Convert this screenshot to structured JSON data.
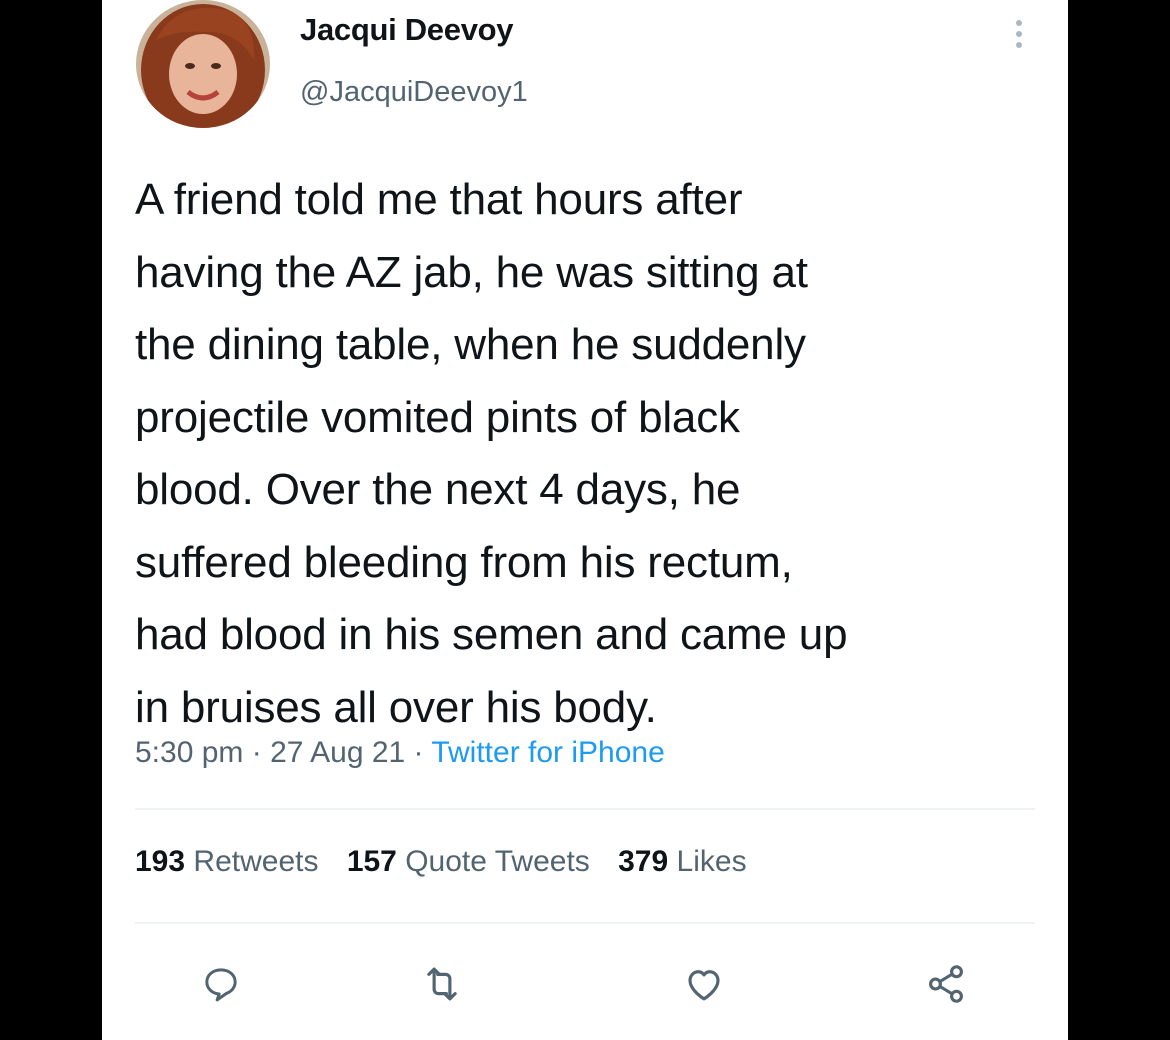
{
  "tweet": {
    "author": {
      "display_name": "Jacqui Deevoy",
      "handle": "@JacquiDeevoy1"
    },
    "text": "A friend told me that hours after\nhaving the AZ jab, he was sitting at\nthe dining table, when he suddenly\nprojectile vomited pints of black\nblood. Over the next 4 days, he\nsuffered bleeding from his rectum,\nhad blood in his semen and came up\nin bruises all over his body.",
    "time": "5:30 pm",
    "date": "27 Aug 21",
    "separator": " · ",
    "source": "Twitter for iPhone",
    "stats": {
      "retweets": {
        "count": "193",
        "label": "Retweets"
      },
      "quotes": {
        "count": "157",
        "label": "Quote Tweets"
      },
      "likes": {
        "count": "379",
        "label": "Likes"
      }
    },
    "actions": [
      "reply-icon",
      "retweet-icon",
      "like-icon",
      "share-icon"
    ]
  },
  "colors": {
    "text": "#0f1419",
    "secondary": "#536471",
    "link": "#1d9bf0",
    "divider": "#eff3f4",
    "backdrop": "#000000"
  }
}
